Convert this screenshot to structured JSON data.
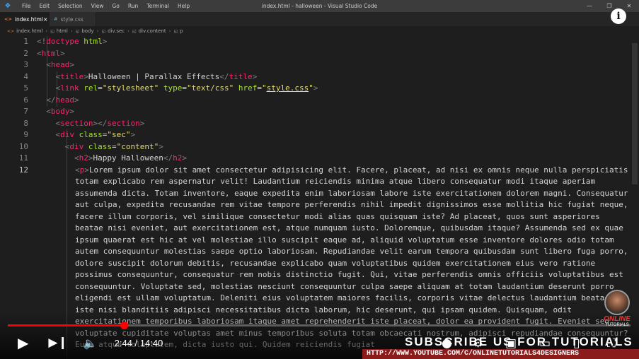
{
  "titlebar": {
    "menu": [
      "File",
      "Edit",
      "Selection",
      "View",
      "Go",
      "Run",
      "Terminal",
      "Help"
    ],
    "window_title": "index.html - halloween - Visual Studio Code"
  },
  "tabs": [
    {
      "icon": "<>",
      "label": "index.html",
      "active": true
    },
    {
      "icon": "#",
      "label": "style.css",
      "active": false
    }
  ],
  "breadcrumb": [
    "index.html",
    "html",
    "body",
    "div.sec",
    "div.content",
    "p"
  ],
  "line_numbers": [
    "1",
    "2",
    "3",
    "4",
    "5",
    "6",
    "7",
    "8",
    "9",
    "10",
    "11",
    "12"
  ],
  "code": {
    "l1": {
      "a": "<!",
      "b": "doctype",
      "c": " html",
      "d": ">"
    },
    "l2_tag": "html",
    "l3_tag": "head",
    "l4": {
      "tag": "title",
      "text": "Halloween | Parallax Effects"
    },
    "l5": {
      "tag": "link",
      "attr1": "rel",
      "val1": "\"stylesheet\"",
      "attr2": "type",
      "val2": "\"text/css\"",
      "attr3": "href",
      "val3_q1": "\"",
      "val3": "style.css",
      "val3_q2": "\""
    },
    "l6_tag": "head",
    "l7_tag": "body",
    "l8_tag": "section",
    "l9": {
      "tag": "div",
      "attr": "class",
      "val": "\"sec\""
    },
    "l10": {
      "tag": "div",
      "attr": "class",
      "val": "\"content\""
    },
    "l11": {
      "tag": "h2",
      "text": "Happy Halloween"
    },
    "l12_tag": "p",
    "paragraph": "Lorem ipsum dolor sit amet consectetur adipisicing elit. Facere, placeat, ad nisi ex omnis neque nulla perspiciatis totam explicabo rem aspernatur velit! Laudantium reiciendis minima atque libero consequatur modi itaque aperiam assumenda dicta. Totam inventore, eaque expedita enim laboriosam labore iste exercitationem dolorem magni. Consequatur aut culpa, expedita recusandae rem vitae tempore perferendis nihil impedit dignissimos esse mollitia hic fugiat neque, facere illum corporis, vel similique consectetur modi alias quas quisquam iste? Ad placeat, quos sunt asperiores beatae nisi eveniet, aut exercitationem est, atque numquam iusto. Doloremque, quibusdam itaque? Assumenda sed ex quae ipsum quaerat est hic at vel molestiae illo suscipit eaque ad, aliquid voluptatum esse inventore dolores odio totam autem consequuntur molestias saepe optio laboriosam. Repudiandae velit earum tempora quibusdam sunt libero fuga porro, dolore suscipit dolorum debitis, recusandae explicabo quam voluptatibus quidem exercitationem eius vero ratione possimus consequuntur, consequatur rem nobis distinctio fugit. Qui, vitae perferendis omnis officiis voluptatibus est consequuntur. Voluptate sed, molestias nesciunt consequuntur culpa saepe aliquam at totam laudantium deserunt porro eligendi est ullam voluptatum. Deleniti eius voluptatem maiores facilis, corporis vitae delectus laudantium beatae iste nisi blanditiis adipisci necessitatibus dicta laborum, hic deserunt, qui ipsam quidem. Quisquam, odit exercitationem temporibus laboriosam itaque amet reprehenderit iste placeat, dolor ea provident fugit. Eveniet sed voluptate cupiditate voluptas amet minus temporibus soluta totam obcaecati nostrum, adipisci repudiandae consequuntur? Eum, atque voluptatem, dicta iusto qui. Quidem reiciendis fugiat"
  },
  "video": {
    "time": "2:44 / 14:40",
    "progress_fraction": 0.186,
    "subscribe_text": "SUBSCRIBE US FOR TUTORIALS VIDEO",
    "url": "HTTP://WWW.YOUTUBE.COM/C/ONLINETUTORIALS4DESIGNERS",
    "logo_line1": "ONLINE",
    "logo_line2": "TUTORIALS"
  }
}
